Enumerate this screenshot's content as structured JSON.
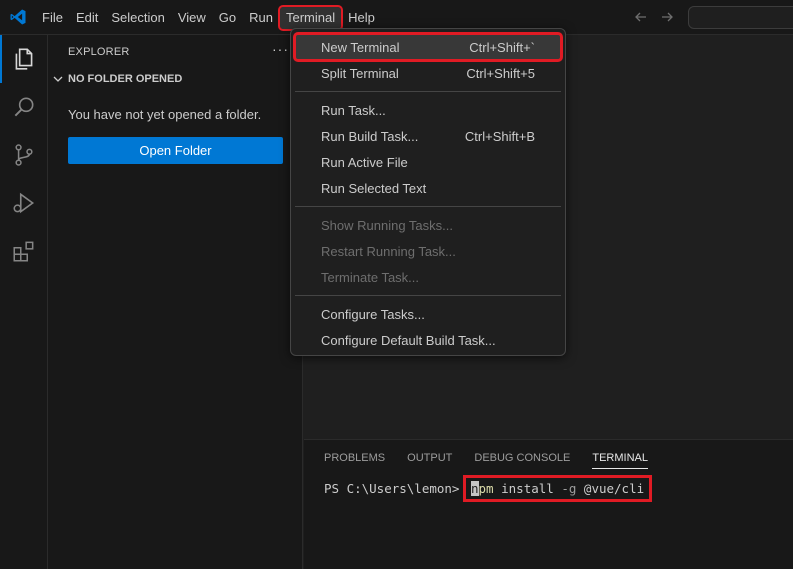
{
  "menubar": {
    "items": [
      "File",
      "Edit",
      "Selection",
      "View",
      "Go",
      "Run",
      "Terminal",
      "Help"
    ],
    "active_item": "Terminal"
  },
  "sidebar": {
    "title": "EXPLORER",
    "more": "···",
    "section_label": "NO FOLDER OPENED",
    "message": "You have not yet opened a folder.",
    "open_folder_button": "Open Folder"
  },
  "terminal_menu": {
    "groups": [
      [
        {
          "label": "New Terminal",
          "shortcut": "Ctrl+Shift+`",
          "highlighted": true
        },
        {
          "label": "Split Terminal",
          "shortcut": "Ctrl+Shift+5"
        }
      ],
      [
        {
          "label": "Run Task...",
          "shortcut": ""
        },
        {
          "label": "Run Build Task...",
          "shortcut": "Ctrl+Shift+B"
        },
        {
          "label": "Run Active File",
          "shortcut": ""
        },
        {
          "label": "Run Selected Text",
          "shortcut": ""
        }
      ],
      [
        {
          "label": "Show Running Tasks...",
          "shortcut": "",
          "disabled": true
        },
        {
          "label": "Restart Running Task...",
          "shortcut": "",
          "disabled": true
        },
        {
          "label": "Terminate Task...",
          "shortcut": "",
          "disabled": true
        }
      ],
      [
        {
          "label": "Configure Tasks...",
          "shortcut": ""
        },
        {
          "label": "Configure Default Build Task...",
          "shortcut": ""
        }
      ]
    ]
  },
  "panel": {
    "tabs": [
      "PROBLEMS",
      "OUTPUT",
      "DEBUG CONSOLE",
      "TERMINAL"
    ],
    "active_tab": "TERMINAL",
    "prompt": "PS C:\\Users\\lemon> ",
    "command": {
      "cursor_char": "n",
      "rest_of_npm": "pm",
      "args1": " install ",
      "flag": "-g",
      "args2": " @vue/cli"
    }
  },
  "colors": {
    "accent": "#0078d4",
    "highlight_box": "#e01b24"
  },
  "icons": {
    "activity_bar": [
      "explorer-icon",
      "search-icon",
      "source-control-icon",
      "run-debug-icon",
      "extensions-icon"
    ]
  }
}
